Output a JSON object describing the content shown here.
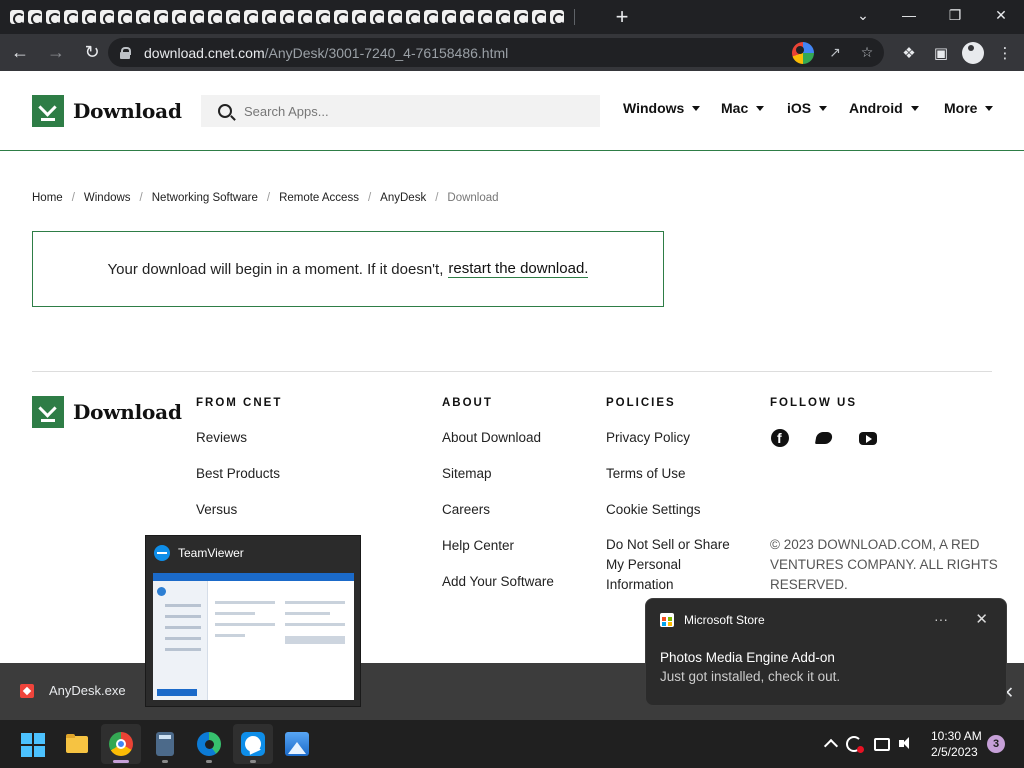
{
  "browser": {
    "tab_count": 31,
    "new_tab_label": "+",
    "window_controls": {
      "tab_search": "⌄",
      "minimize": "—",
      "restore": "❐",
      "close": "✕"
    },
    "url_host": "download.cnet.com",
    "url_path": "/AnyDesk/3001-7240_4-76158486.html"
  },
  "site": {
    "logo_text": "Download",
    "search_placeholder": "Search Apps...",
    "nav": [
      "Windows",
      "Mac",
      "iOS",
      "Android",
      "More"
    ]
  },
  "breadcrumb": [
    "Home",
    "Windows",
    "Networking Software",
    "Remote Access",
    "AnyDesk",
    "Download"
  ],
  "notice": {
    "text": "Your download will begin in a moment. If it doesn't,",
    "link": "restart the download."
  },
  "footer": {
    "logo_text": "Download",
    "from_cnet": {
      "heading": "FROM CNET",
      "links": [
        "Reviews",
        "Best Products",
        "Versus"
      ]
    },
    "about": {
      "heading": "ABOUT",
      "links": [
        "About Download",
        "Sitemap",
        "Careers",
        "Help Center",
        "Add Your Software"
      ]
    },
    "policies": {
      "heading": "POLICIES",
      "links": [
        "Privacy Policy",
        "Terms of Use",
        "Cookie Settings",
        "Do Not Sell or Share My Personal Information"
      ]
    },
    "follow": {
      "heading": "FOLLOW US",
      "icons": [
        "facebook-icon",
        "twitter-icon",
        "youtube-icon"
      ]
    },
    "copyright": "© 2023 DOWNLOAD.COM, A RED VENTURES COMPANY. ALL RIGHTS RESERVED."
  },
  "downloads_bar": {
    "file_name": "AnyDesk.exe",
    "close_glyph": "✕"
  },
  "thumbnail_popup": {
    "title": "TeamViewer"
  },
  "toast": {
    "app": "Microsoft Store",
    "more": "···",
    "close": "✕",
    "title": "Photos Media Engine Add-on",
    "body": "Just got installed, check it out."
  },
  "taskbar": {
    "apps": [
      "start-icon",
      "file-explorer-icon",
      "chrome-icon",
      "calculator-icon",
      "edge-icon",
      "teamviewer-icon",
      "photos-icon"
    ],
    "time": "10:30 AM",
    "date": "2/5/2023",
    "notification_count": "3"
  },
  "colors": {
    "brand_green": "#2e7d46",
    "chrome_dark": "#202124",
    "taskbar": "#202020"
  }
}
